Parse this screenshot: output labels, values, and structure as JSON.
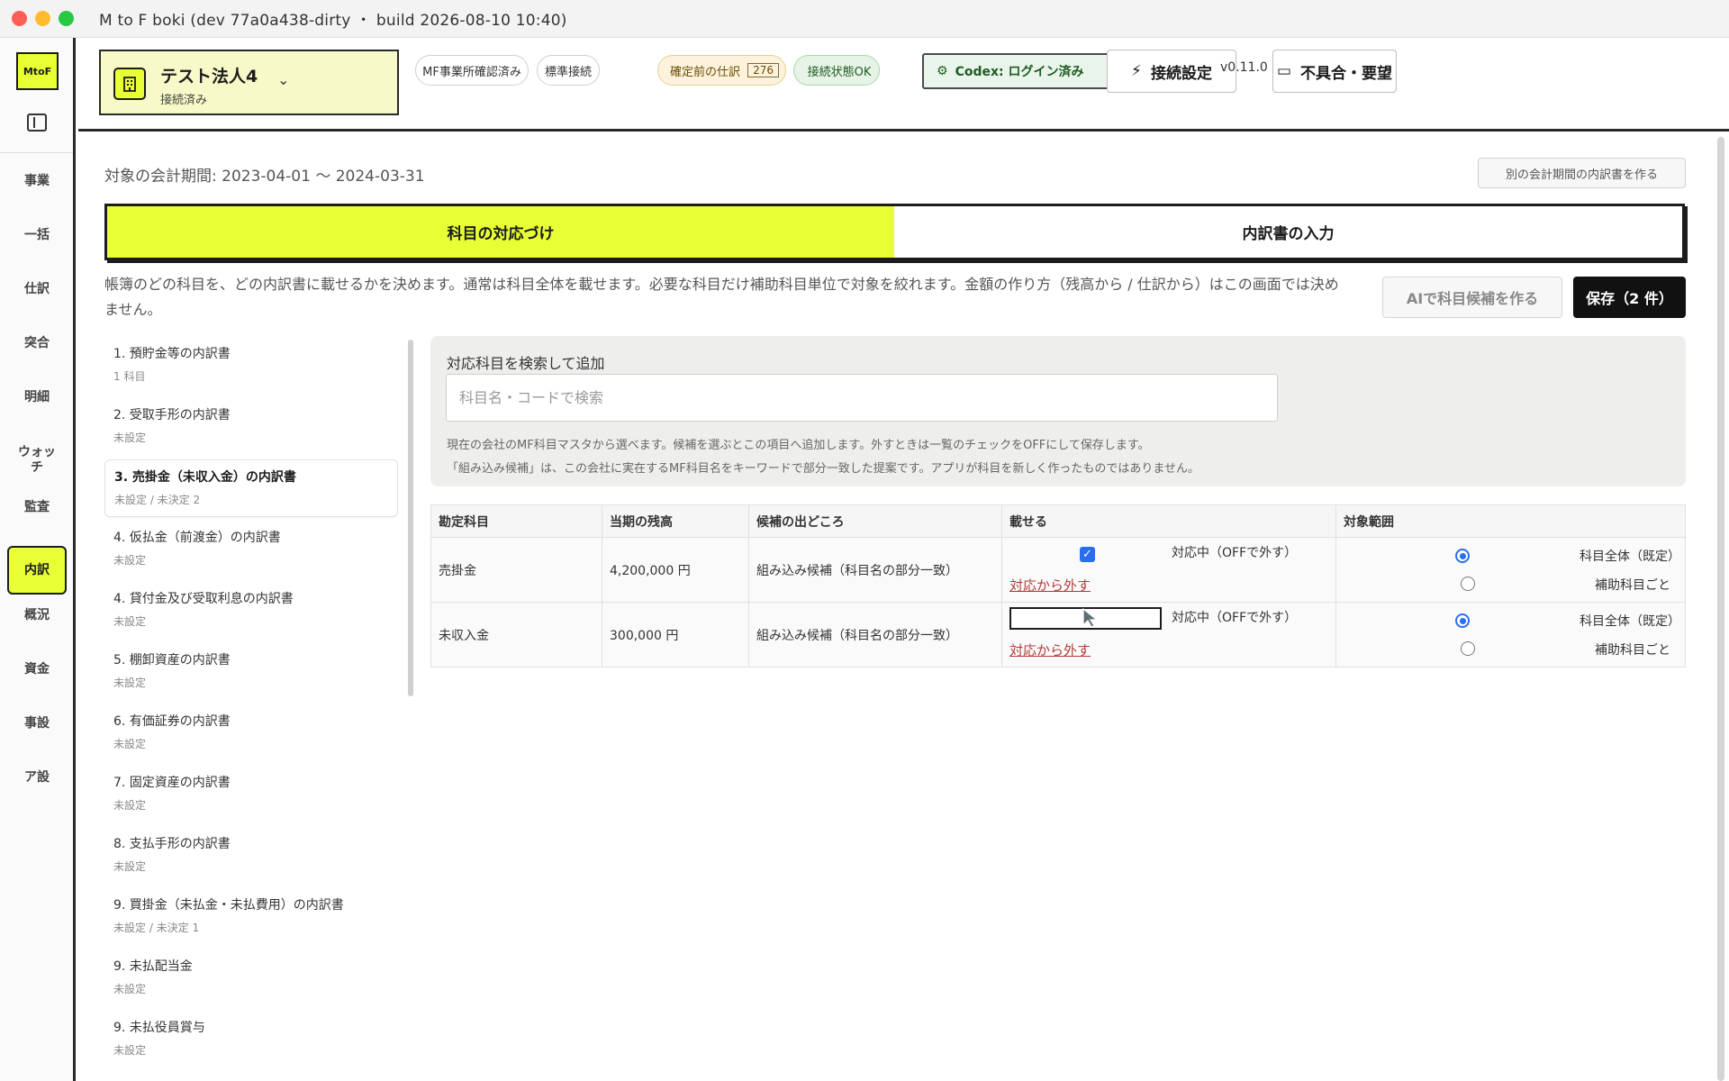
{
  "window": {
    "title": "M to F boki (dev 77a0a438-dirty ・ build 2026-08-10 10:40)"
  },
  "rail": {
    "logo": "MtoF",
    "items": [
      "事業",
      "一括",
      "仕訳",
      "突合",
      "明細",
      "ウォッチ",
      "監査",
      "内訳",
      "概況",
      "資金",
      "事設",
      "ア設"
    ],
    "active": "内訳"
  },
  "header": {
    "company_name": "テスト法人4",
    "company_status": "接続済み",
    "pill_mf": "MF事業所確認済み",
    "pill_standard": "標準接続",
    "pending_label": "確定前の仕訳",
    "pending_count": "276",
    "connection_ok": "接続状態OK",
    "codex": "Codex: ログイン済み",
    "connect_settings": "接続設定",
    "version": "v0.11.0",
    "feedback": "不具合・要望"
  },
  "main": {
    "period": "対象の会計期間: 2023-04-01 〜 2024-03-31",
    "other_period_button": "別の会計期間の内訳書を作る",
    "tabs": [
      "科目の対応づけ",
      "内訳書の入力"
    ],
    "description": "帳簿のどの科目を、どの内訳書に載せるかを決めます。通常は科目全体を載せます。必要な科目だけ補助科目単位で対象を絞れます。金額の作り方（残高から / 仕訳から）はこの画面では決めません。",
    "ai_button": "AIで科目候補を作る",
    "save_button": "保存（2 件）"
  },
  "statements": [
    {
      "name": "1. 預貯金等の内訳書",
      "sub": "1 科目"
    },
    {
      "name": "2. 受取手形の内訳書",
      "sub": "未設定"
    },
    {
      "name": "3. 売掛金（未収入金）の内訳書",
      "sub": "未設定 / 未決定 2"
    },
    {
      "name": "4. 仮払金（前渡金）の内訳書",
      "sub": "未設定"
    },
    {
      "name": "4. 貸付金及び受取利息の内訳書",
      "sub": "未設定"
    },
    {
      "name": "5. 棚卸資産の内訳書",
      "sub": "未設定"
    },
    {
      "name": "6. 有価証券の内訳書",
      "sub": "未設定"
    },
    {
      "name": "7. 固定資産の内訳書",
      "sub": "未設定"
    },
    {
      "name": "8. 支払手形の内訳書",
      "sub": "未設定"
    },
    {
      "name": "9. 買掛金（未払金・未払費用）の内訳書",
      "sub": "未設定 / 未決定 1"
    },
    {
      "name": "9. 未払配当金",
      "sub": "未設定"
    },
    {
      "name": "9. 未払役員賞与",
      "sub": "未設定"
    }
  ],
  "search": {
    "label": "対応科目を検索して追加",
    "placeholder": "科目名・コードで検索",
    "note1": "現在の会社のMF科目マスタから選べます。候補を選ぶとこの項目へ追加します。外すときは一覧のチェックをOFFにして保存します。",
    "note2": "「組み込み候補」は、この会社に実在するMF科目名をキーワードで部分一致した提案です。アプリが科目を新しく作ったものではありません。"
  },
  "table": {
    "headers": [
      "勘定科目",
      "当期の残高",
      "候補の出どころ",
      "載せる",
      "対象範囲"
    ],
    "rows": [
      {
        "account": "売掛金",
        "balance": "4,200,000 円",
        "source": "組み込み候補（科目名の部分一致）",
        "include_label": "対応中（OFFで外す）",
        "remove": "対応から外す",
        "scope_all": "科目全体（既定）",
        "scope_sub": "補助科目ごと"
      },
      {
        "account": "未収入金",
        "balance": "300,000 円",
        "source": "組み込み候補（科目名の部分一致）",
        "include_label": "対応中（OFFで外す）",
        "remove": "対応から外す",
        "scope_all": "科目全体（既定）",
        "scope_sub": "補助科目ごと"
      }
    ]
  },
  "colors": {
    "accent": "#e8ff35",
    "primary": "#111111",
    "link_red": "#b23b3b",
    "radio_blue": "#2a6ef0"
  }
}
